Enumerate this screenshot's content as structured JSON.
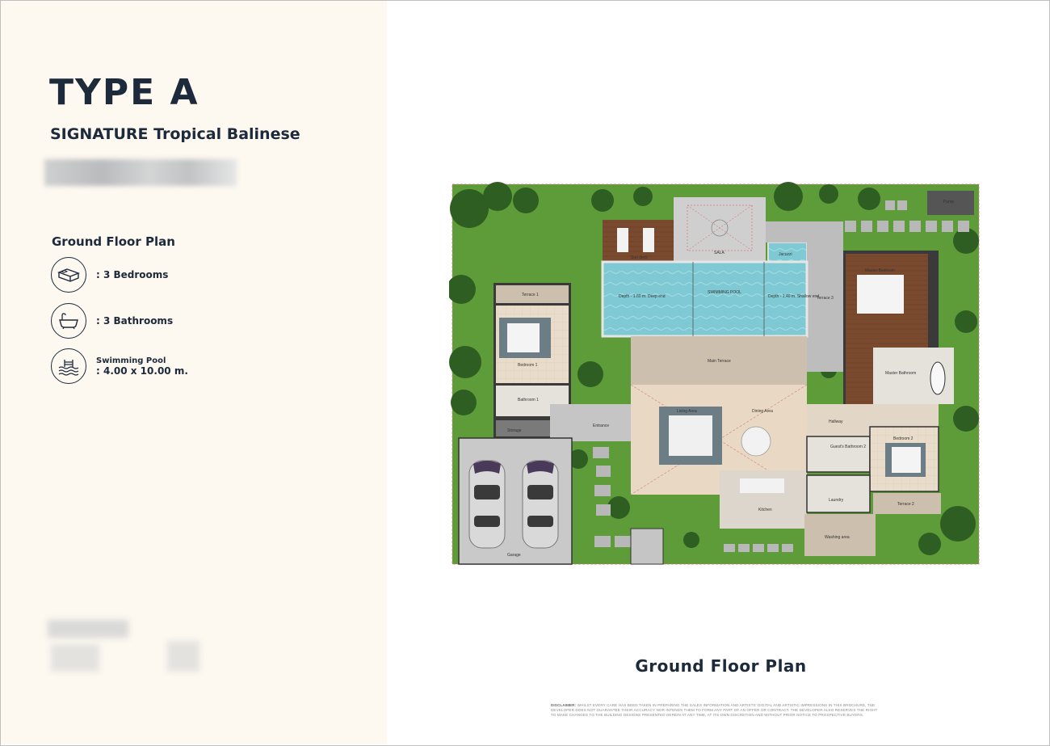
{
  "header": {
    "title": "TYPE A",
    "subtitle": "SIGNATURE Tropical Balinese"
  },
  "features": {
    "heading": "Ground Floor Plan",
    "items": [
      {
        "icon": "bed-icon",
        "label": ": 3 Bedrooms"
      },
      {
        "icon": "bathtub-icon",
        "label": ": 3 Bathrooms"
      },
      {
        "icon": "pool-icon",
        "label_line1": "Swimming Pool",
        "label_line2": ": 4.00 x 10.00 m."
      }
    ]
  },
  "plan": {
    "caption": "Ground Floor Plan",
    "rooms": {
      "sala": "SALA",
      "swimming_pool": "SWIMMING POOL",
      "deep_end": "Depth - 1.60 m. Deep end",
      "shallow_end": "Depth - 1.40 m. Shallow end",
      "jacuzzi": "Jacuzzi",
      "sundeck": "Sun deck",
      "terrace1": "Terrace 1",
      "terrace2": "Terrace 2",
      "terrace3": "Terrace 3",
      "main_terrace": "Main Terrace",
      "bedroom1": "Bedroom 1",
      "bathroom1": "Bathroom 1",
      "storage": "Storage",
      "entrance": "Entrance",
      "living_area": "Living Area",
      "dining_area": "Dining Area",
      "kitchen": "Kitchen",
      "master_bedroom": "Master Bedroom",
      "master_bathroom": "Master Bathroom",
      "hallway": "Hallway",
      "guest_bathroom": "Guest's Bathroom 2",
      "bedroom2": "Bedroom 2",
      "laundry": "Laundry",
      "washing_area": "Washing area",
      "garage": "Garage",
      "pump": "Pump"
    }
  },
  "disclaimer": {
    "label": "DISCLAIMER:",
    "text": "WHILST EVERY CARE HAS BEEN TAKEN IN PREPARING THE SALES INFORMATION AND ARTISTS' DIGITAL AND ARTISTIC IMPRESSIONS IN THIS BROCHURE, THE DEVELOPER DOES NOT GUARANTEE THEIR ACCURACY NOR INTENDS THEM TO FORM ANY PART OF AN OFFER OR CONTRACT. THE DEVELOPER ALSO RESERVES THE RIGHT TO MAKE CHANGES TO THE BUILDING DESIGNS PRESENTED HEREIN AT ANY TIME, AT ITS OWN DISCRETION AND WITHOUT PRIOR NOTICE TO PROSPECTIVE BUYERS."
  }
}
